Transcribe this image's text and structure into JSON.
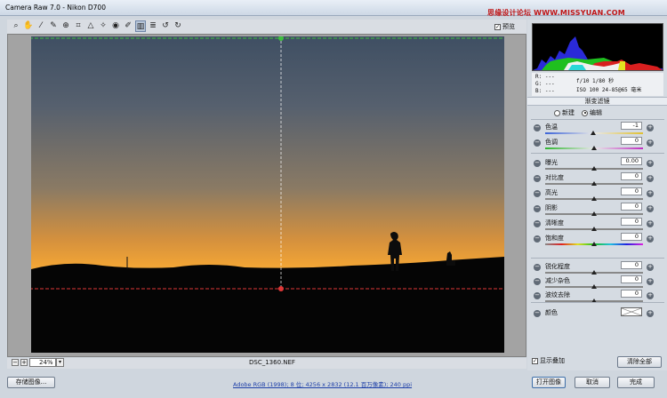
{
  "window": {
    "title": "Camera Raw 7.0  -  Nikon D700",
    "watermark": "思缘设计论坛 WWW.MISSYUAN.COM"
  },
  "toolbar": {
    "tools": [
      "zoom-icon",
      "hand-icon",
      "white-balance-icon",
      "color-sampler-icon",
      "target-adjust-icon",
      "crop-icon",
      "straighten-icon",
      "spot-removal-icon",
      "red-eye-icon",
      "adjustment-brush-icon",
      "graduated-filter-icon",
      "preferences-icon",
      "rotate-ccw-icon",
      "rotate-cw-icon"
    ],
    "preview_label": "预览",
    "preview_checked": true
  },
  "canvas": {
    "filename": "DSC_1360.NEF",
    "zoom": "24%"
  },
  "meta": {
    "r": "R:  ---",
    "g": "G:  ---",
    "b": "B:  ---",
    "exif1": "f/10   1/80 秒",
    "exif2": "ISO 100  24-85@65 毫米"
  },
  "panel": {
    "title": "渐变滤镜",
    "mode_new": "新建",
    "mode_edit": "编辑",
    "active_mode": "edit",
    "sliders_group1": [
      {
        "label": "色温",
        "value": "-1",
        "pos": 0.49,
        "track": "temp"
      },
      {
        "label": "色调",
        "value": "0",
        "pos": 0.5,
        "track": "tint"
      }
    ],
    "sliders_group2": [
      {
        "label": "曝光",
        "value": "0.00",
        "pos": 0.5
      },
      {
        "label": "对比度",
        "value": "0",
        "pos": 0.5
      },
      {
        "label": "高光",
        "value": "0",
        "pos": 0.5
      },
      {
        "label": "阴影",
        "value": "0",
        "pos": 0.5
      },
      {
        "label": "清晰度",
        "value": "0",
        "pos": 0.5
      },
      {
        "label": "饱和度",
        "value": "0",
        "pos": 0.5,
        "track": "sat"
      }
    ],
    "sliders_group3": [
      {
        "label": "锐化程度",
        "value": "0",
        "pos": 0.5
      },
      {
        "label": "减少杂色",
        "value": "0",
        "pos": 0.5
      },
      {
        "label": "波纹去除",
        "value": "0",
        "pos": 0.5
      }
    ],
    "color_label": "颜色",
    "overlay_label": "显示叠加",
    "overlay_checked": true,
    "clear_all": "清除全部"
  },
  "bottom": {
    "save_image": "存储图像...",
    "workflow_link": "Adobe RGB (1998); 8 位; 4256 x 2832 (12.1 百万像素); 240 ppi",
    "open_image": "打开图像",
    "cancel": "取消",
    "done": "完成"
  }
}
